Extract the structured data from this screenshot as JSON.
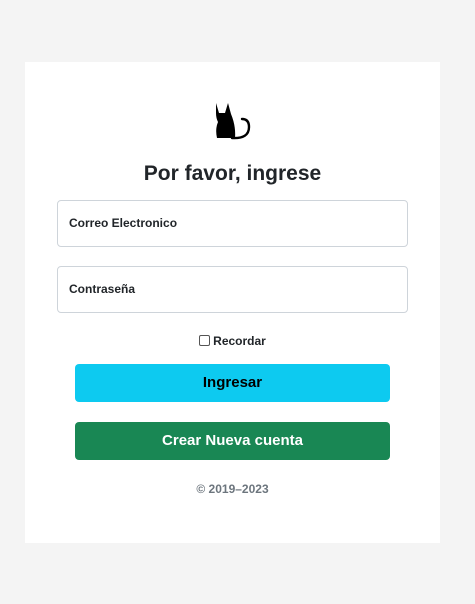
{
  "logo": {
    "icon": "cat-icon",
    "color": "#000000"
  },
  "form": {
    "heading": "Por favor, ingrese",
    "email_label": "Correo Electronico",
    "email_value": "",
    "password_label": "Contraseña",
    "password_value": "",
    "remember_label": "Recordar",
    "remember_checked": false,
    "login_button": "Ingresar",
    "register_button": "Crear Nueva cuenta"
  },
  "footer": {
    "copyright": "© 2019–2023"
  },
  "colors": {
    "page_background": "#f4f4f4",
    "card_background": "#ffffff",
    "login_button": "#0dcaf0",
    "register_button": "#198754",
    "muted_text": "#6c757d"
  }
}
